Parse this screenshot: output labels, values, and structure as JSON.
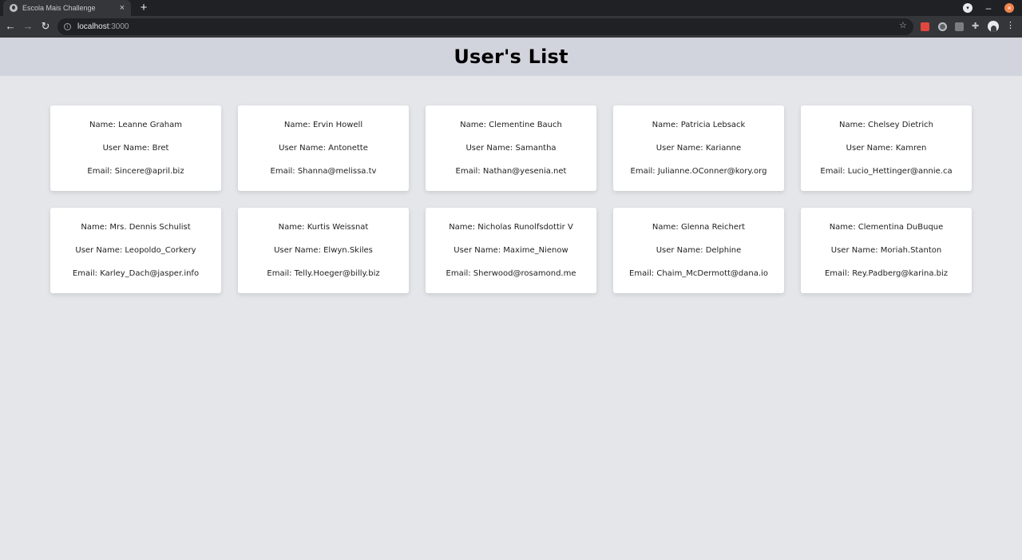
{
  "browser": {
    "tab_title": "Escola Mais Challenge",
    "tab_close": "×",
    "new_tab": "+",
    "url_host": "localhost",
    "url_port": ":3000"
  },
  "page": {
    "title": "User's List"
  },
  "users": [
    {
      "name": "Name: Leanne Graham",
      "username": "User Name: Bret",
      "email": "Email: Sincere@april.biz"
    },
    {
      "name": "Name: Ervin Howell",
      "username": "User Name: Antonette",
      "email": "Email: Shanna@melissa.tv"
    },
    {
      "name": "Name: Clementine Bauch",
      "username": "User Name: Samantha",
      "email": "Email: Nathan@yesenia.net"
    },
    {
      "name": "Name: Patricia Lebsack",
      "username": "User Name: Karianne",
      "email": "Email: Julianne.OConner@kory.org"
    },
    {
      "name": "Name: Chelsey Dietrich",
      "username": "User Name: Kamren",
      "email": "Email: Lucio_Hettinger@annie.ca"
    },
    {
      "name": "Name: Mrs. Dennis Schulist",
      "username": "User Name: Leopoldo_Corkery",
      "email": "Email: Karley_Dach@jasper.info"
    },
    {
      "name": "Name: Kurtis Weissnat",
      "username": "User Name: Elwyn.Skiles",
      "email": "Email: Telly.Hoeger@billy.biz"
    },
    {
      "name": "Name: Nicholas Runolfsdottir V",
      "username": "User Name: Maxime_Nienow",
      "email": "Email: Sherwood@rosamond.me"
    },
    {
      "name": "Name: Glenna Reichert",
      "username": "User Name: Delphine",
      "email": "Email: Chaim_McDermott@dana.io"
    },
    {
      "name": "Name: Clementina DuBuque",
      "username": "User Name: Moriah.Stanton",
      "email": "Email: Rey.Padberg@karina.biz"
    }
  ]
}
